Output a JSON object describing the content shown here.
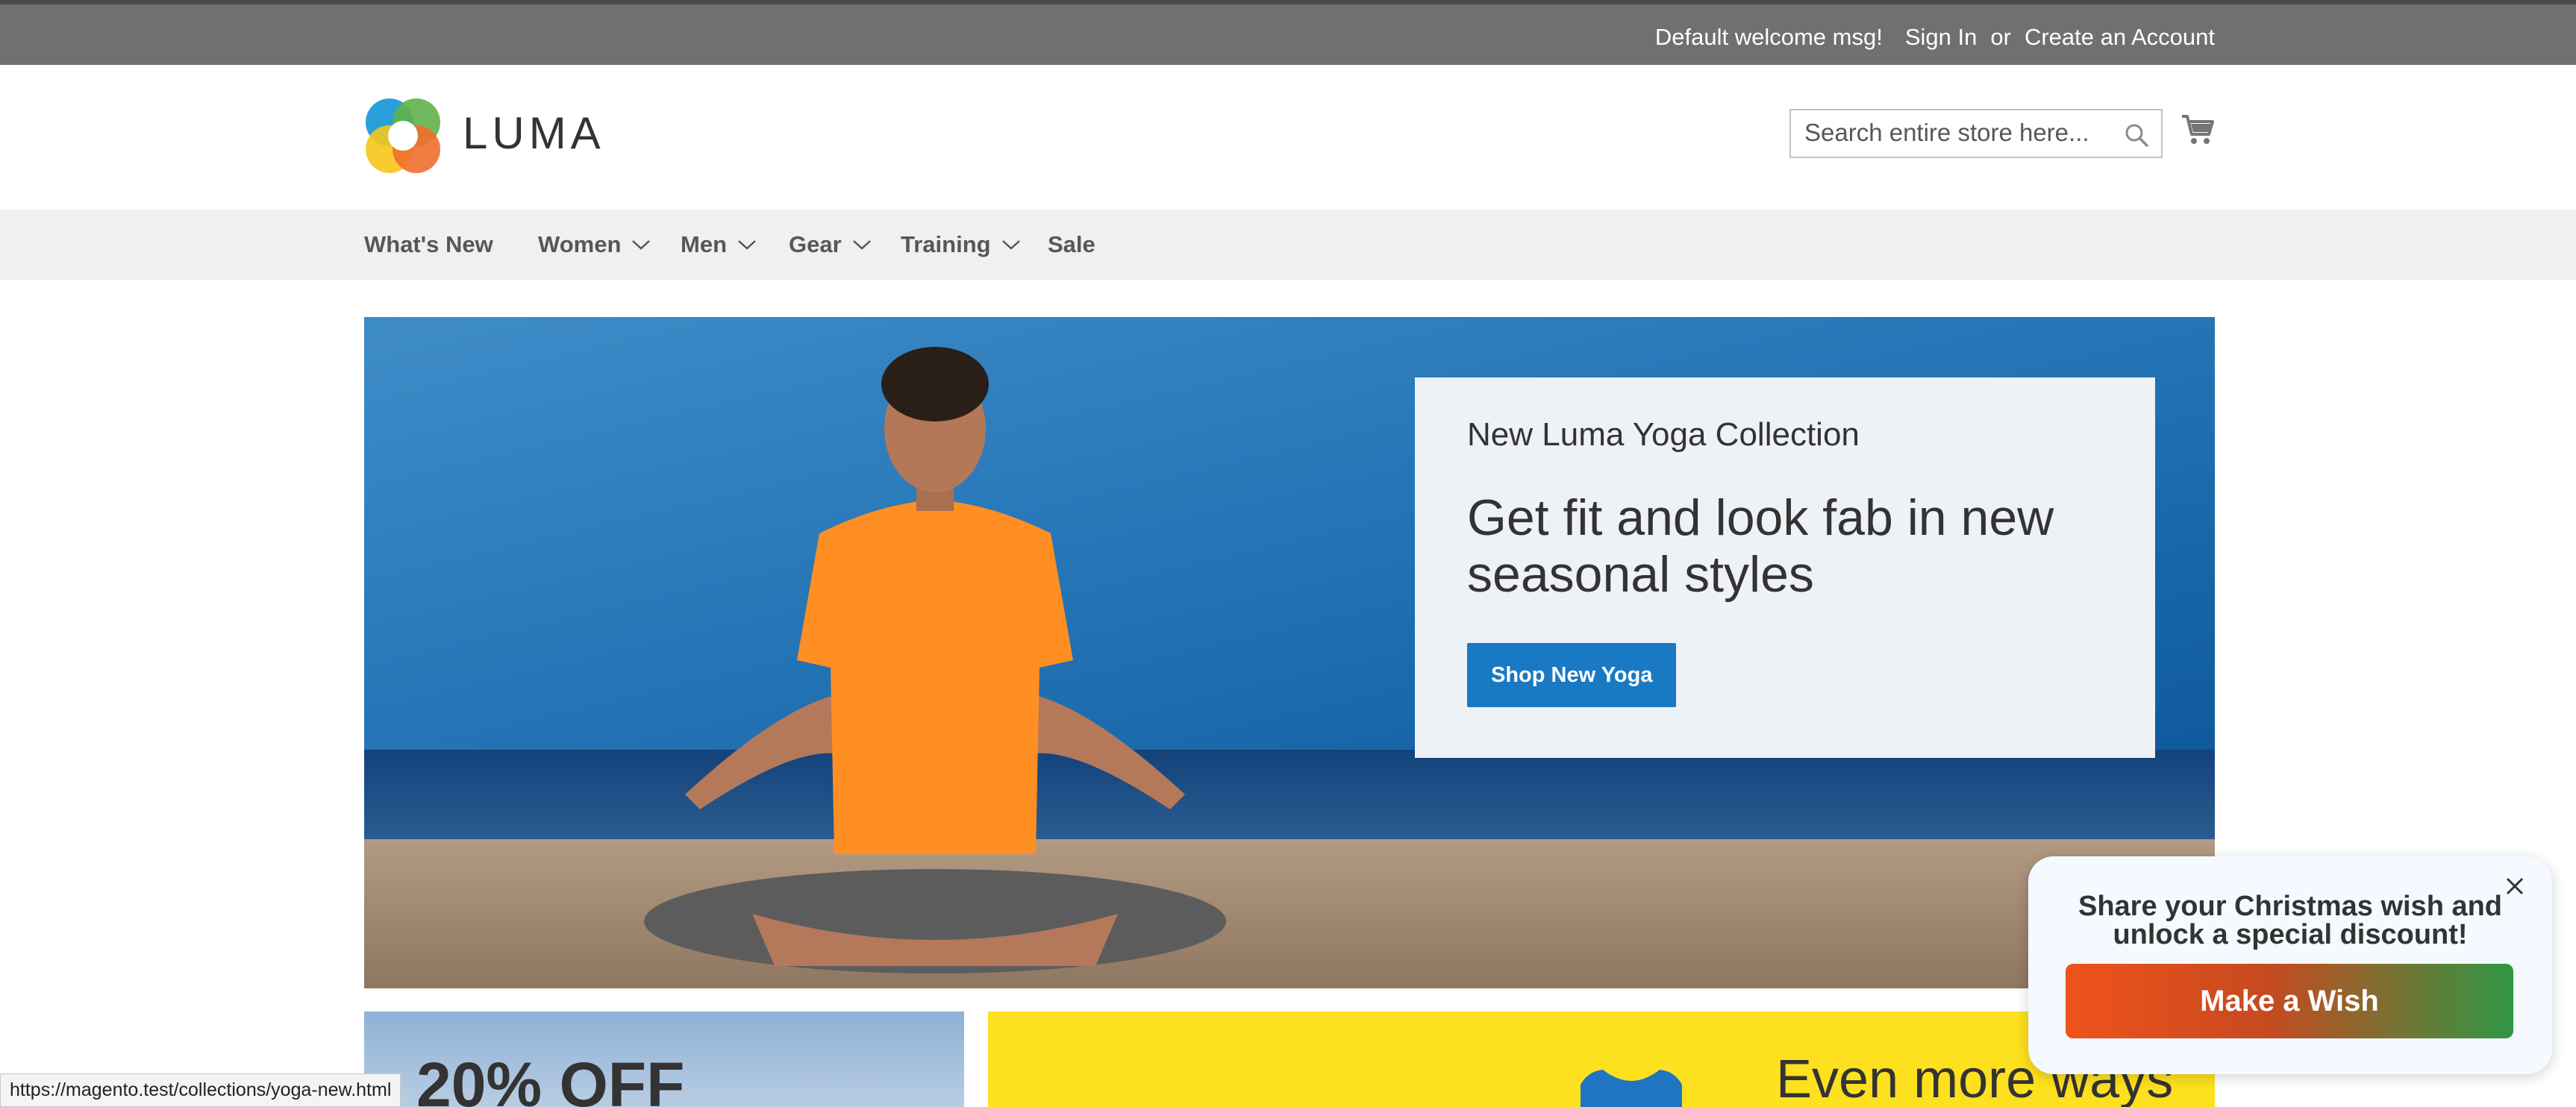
{
  "topbar": {
    "welcome": "Default welcome msg!",
    "sign_in": "Sign In",
    "or": "or",
    "create_account": "Create an Account"
  },
  "header": {
    "logo_text": "LUMA",
    "search_placeholder": "Search entire store here...",
    "icons": [
      "luma-logo",
      "search-icon",
      "cart-icon"
    ]
  },
  "nav": {
    "items": [
      {
        "label": "What's New",
        "has_dropdown": false
      },
      {
        "label": "Women",
        "has_dropdown": true
      },
      {
        "label": "Men",
        "has_dropdown": true
      },
      {
        "label": "Gear",
        "has_dropdown": true
      },
      {
        "label": "Training",
        "has_dropdown": true
      },
      {
        "label": "Sale",
        "has_dropdown": false
      }
    ]
  },
  "hero": {
    "subtitle": "New Luma Yoga Collection",
    "title": "Get fit and look fab in new seasonal styles",
    "button": "Shop New Yoga"
  },
  "blocks": {
    "left_text": "20% OFF",
    "right_text": "Even more ways"
  },
  "status_bar": {
    "url": "https://magento.test/collections/yoga-new.html"
  },
  "popup": {
    "text": "Share your Christmas wish and unlock a special discount!",
    "button": "Make a Wish"
  },
  "colors": {
    "topbar": "#6e716e",
    "nav_bg": "#f0f0f0",
    "primary_button": "#1979c3",
    "promo_yellow": "#fde01e"
  }
}
